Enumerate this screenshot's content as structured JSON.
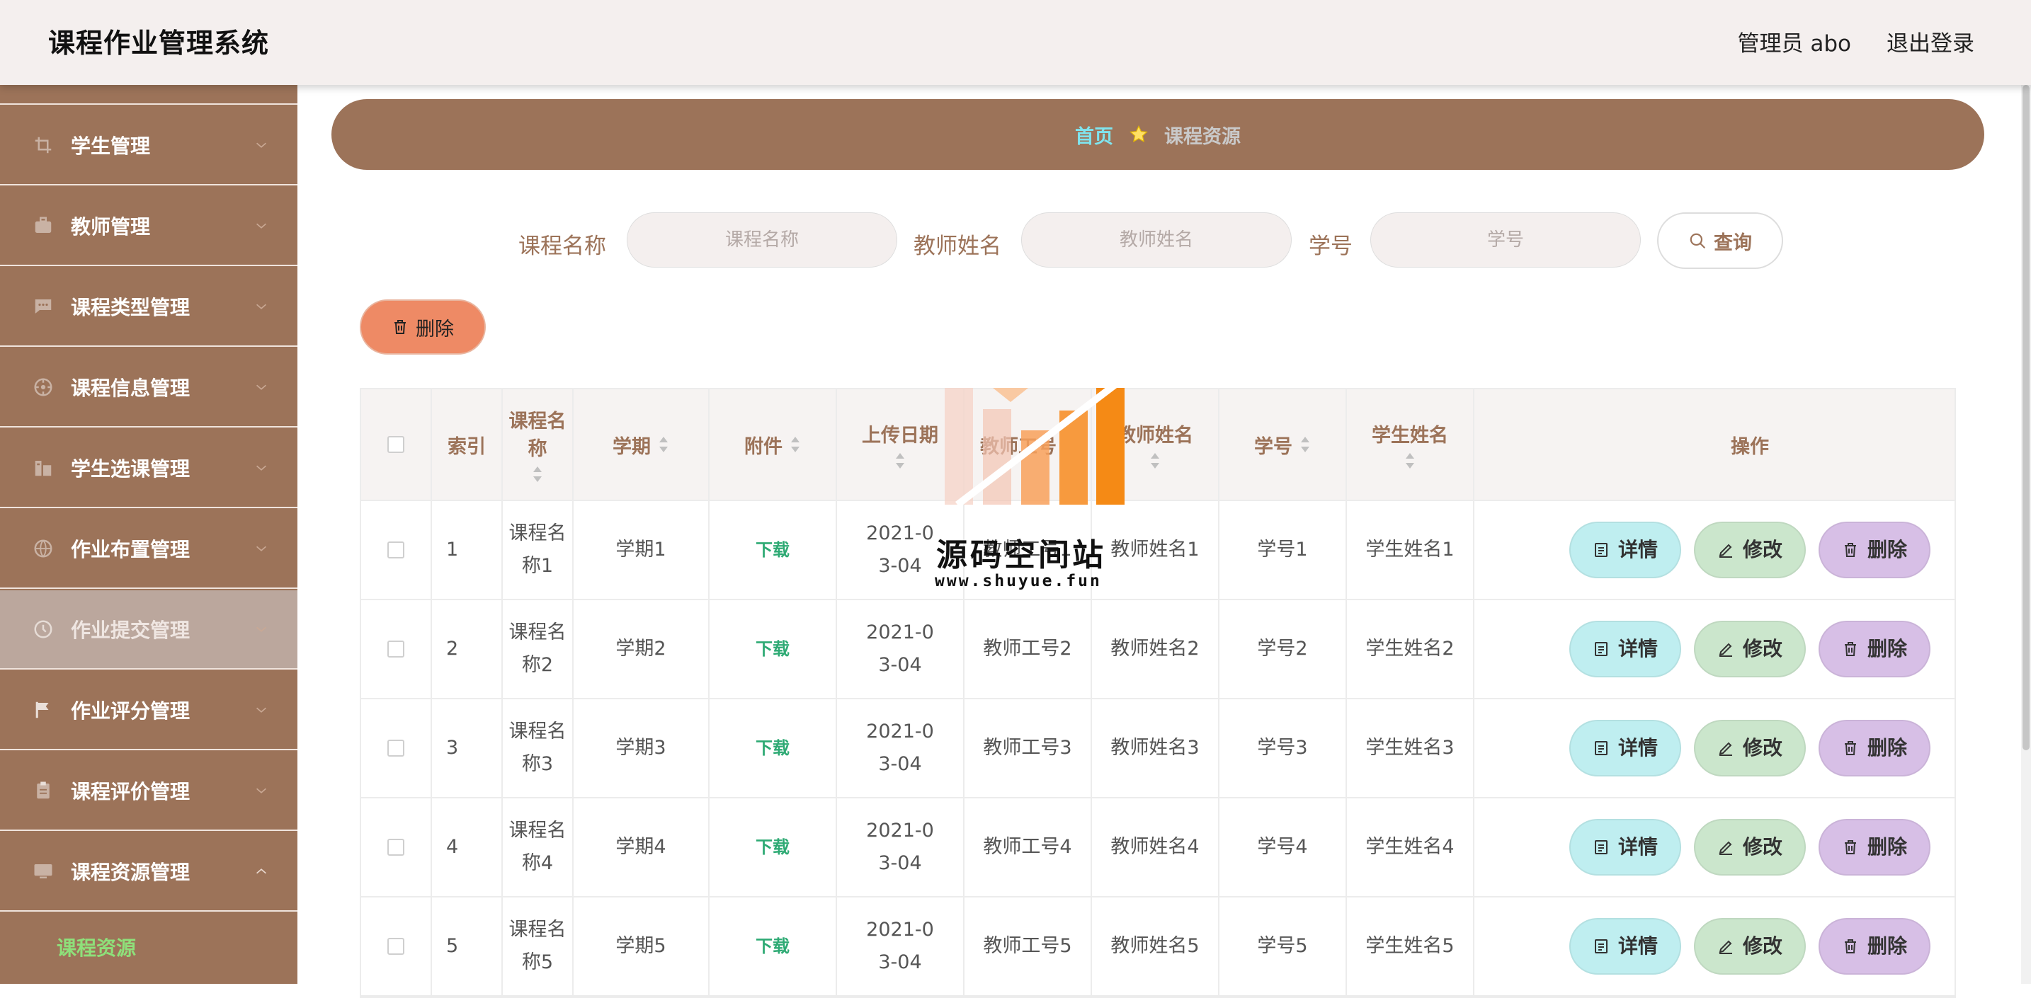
{
  "header": {
    "title": "课程作业管理系统",
    "user_label": "管理员 abo",
    "logout_label": "退出登录"
  },
  "sidebar": {
    "items": [
      {
        "label": "学生管理",
        "icon": "crop-icon"
      },
      {
        "label": "教师管理",
        "icon": "briefcase-icon"
      },
      {
        "label": "课程类型管理",
        "icon": "chat-icon"
      },
      {
        "label": "课程信息管理",
        "icon": "compass-icon"
      },
      {
        "label": "学生选课管理",
        "icon": "office-building-icon"
      },
      {
        "label": "作业布置管理",
        "icon": "basketball-icon"
      },
      {
        "label": "作业提交管理",
        "icon": "clock-icon",
        "active": true
      },
      {
        "label": "作业评分管理",
        "icon": "flag-icon"
      },
      {
        "label": "课程评价管理",
        "icon": "clipboard-icon"
      },
      {
        "label": "课程资源管理",
        "icon": "monitor-icon",
        "expanded": true
      }
    ],
    "submenu_item": "课程资源"
  },
  "breadcrumb": {
    "home": "首页",
    "current": "课程资源"
  },
  "search": {
    "course_label": "课程名称",
    "course_placeholder": "课程名称",
    "teacher_label": "教师姓名",
    "teacher_placeholder": "教师姓名",
    "student_no_label": "学号",
    "student_no_placeholder": "学号",
    "query_label": "查询"
  },
  "toolbar": {
    "delete_label": "删除"
  },
  "table": {
    "columns": [
      "索引",
      "课程名称",
      "学期",
      "附件",
      "上传日期",
      "教师工号",
      "教师姓名",
      "学号",
      "学生姓名",
      "操作"
    ],
    "rows": [
      {
        "index": "1",
        "course": "课程名称1",
        "term": "学期1",
        "attachment": "下载",
        "date": "2021-03-04",
        "teacher_no": "教师工号1",
        "teacher": "教师姓名1",
        "student_no": "学号1",
        "student": "学生姓名1"
      },
      {
        "index": "2",
        "course": "课程名称2",
        "term": "学期2",
        "attachment": "下载",
        "date": "2021-03-04",
        "teacher_no": "教师工号2",
        "teacher": "教师姓名2",
        "student_no": "学号2",
        "student": "学生姓名2"
      },
      {
        "index": "3",
        "course": "课程名称3",
        "term": "学期3",
        "attachment": "下载",
        "date": "2021-03-04",
        "teacher_no": "教师工号3",
        "teacher": "教师姓名3",
        "student_no": "学号3",
        "student": "学生姓名3"
      },
      {
        "index": "4",
        "course": "课程名称4",
        "term": "学期4",
        "attachment": "下载",
        "date": "2021-03-04",
        "teacher_no": "教师工号4",
        "teacher": "教师姓名4",
        "student_no": "学号4",
        "student": "学生姓名4"
      },
      {
        "index": "5",
        "course": "课程名称5",
        "term": "学期5",
        "attachment": "下载",
        "date": "2021-03-04",
        "teacher_no": "教师工号5",
        "teacher": "教师姓名5",
        "student_no": "学号5",
        "student": "学生姓名5"
      }
    ],
    "actions": {
      "detail": "详情",
      "edit": "修改",
      "delete": "删除"
    }
  },
  "watermark": {
    "title": "源码空间站",
    "url": "www.shuyue.fun"
  },
  "colors": {
    "brand": "#9c7359",
    "header_bg": "#f4efee",
    "active_item": "#bba79d",
    "breadcrumb_home": "#7fe4ee",
    "delete_button": "#ee8a65",
    "detail_button": "#bfeef0",
    "edit_button": "#cbe6cc",
    "row_delete_button": "#d7bfe6",
    "download_link": "#2eaa74",
    "submenu_text": "#8ee07a"
  }
}
